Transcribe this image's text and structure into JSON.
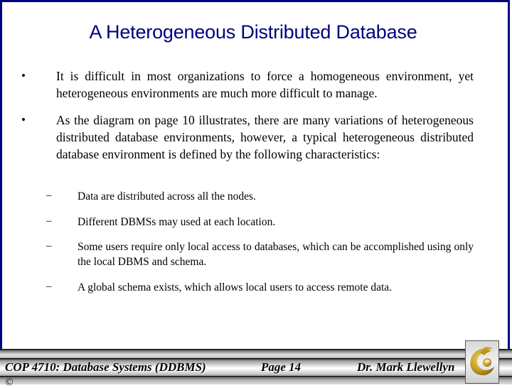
{
  "slide": {
    "title": "A Heterogeneous Distributed Database",
    "bullets": [
      {
        "marker": "•",
        "text": "It is difficult in most organizations to force a homogeneous environment, yet heterogeneous environments are much more difficult to manage."
      },
      {
        "marker": "•",
        "text": "As the diagram on page 10 illustrates, there are many variations of heterogeneous distributed database environments, however, a typical heterogeneous distributed database environment is defined by the following characteristics:"
      }
    ],
    "sub_bullets": [
      {
        "marker": "–",
        "text": "Data are distributed across all the nodes."
      },
      {
        "marker": "–",
        "text": "Different DBMSs may used at each location."
      },
      {
        "marker": "–",
        "text": "Some users require only local access to databases, which can be accomplished using only the local DBMS and schema."
      },
      {
        "marker": "–",
        "text": "A global schema exists, which allows local users to access remote data."
      }
    ]
  },
  "footer": {
    "course": "COP 4710: Database Systems  (DDBMS)",
    "page": "Page 14",
    "author": "Dr. Mark Llewellyn",
    "copyright": "©",
    "logo_icon": "ucf-pegasus-logo-icon"
  },
  "colors": {
    "title": "#000080",
    "frame_border": "#000080",
    "logo_gold": "#c9a227"
  }
}
